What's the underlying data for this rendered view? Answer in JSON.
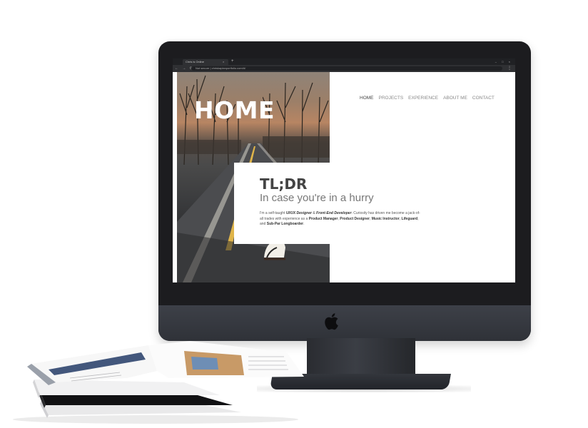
{
  "browser": {
    "tab_title": "Chris is Online",
    "tab_close": "×",
    "new_tab": "+",
    "window_controls": "– □ ×",
    "nav_icons": "← → ⟳",
    "address": "Not secure | chriskaplanportfolio.com/#/",
    "menu": "⋮"
  },
  "page": {
    "title": "HOME",
    "nav": [
      "HOME",
      "PROJECTS",
      "EXPERIENCE",
      "ABOUT ME",
      "CONTACT"
    ],
    "tldr": {
      "title": "TL;DR",
      "subtitle": "In case you're in a hurry",
      "body_intro": "I'm a self-taught ",
      "role_1": "UI/UX Designer",
      "and_1": " & ",
      "role_2": "Front-End Developer",
      "mid": ". Curiosity has driven me become a jack-of-all trades with experience as a ",
      "role_3": "Product Manager",
      "sep_1": ", ",
      "role_4": "Product Designer",
      "sep_2": ",  ",
      "role_5": "Music Instructor",
      "sep_3": ", ",
      "role_6": "Lifeguard",
      "and_2": ", and ",
      "role_7": "Sub-Par Longboarder",
      "end": "."
    }
  },
  "colors": {
    "monitor_bezel": "#1c1c1f",
    "monitor_chin": "#3d4048",
    "active_nav": "#444444",
    "inactive_nav": "#888888"
  },
  "icons": [
    "apple-logo-icon",
    "close-icon",
    "plus-icon",
    "back-arrow-icon",
    "forward-arrow-icon",
    "reload-icon",
    "menu-dots-icon"
  ]
}
